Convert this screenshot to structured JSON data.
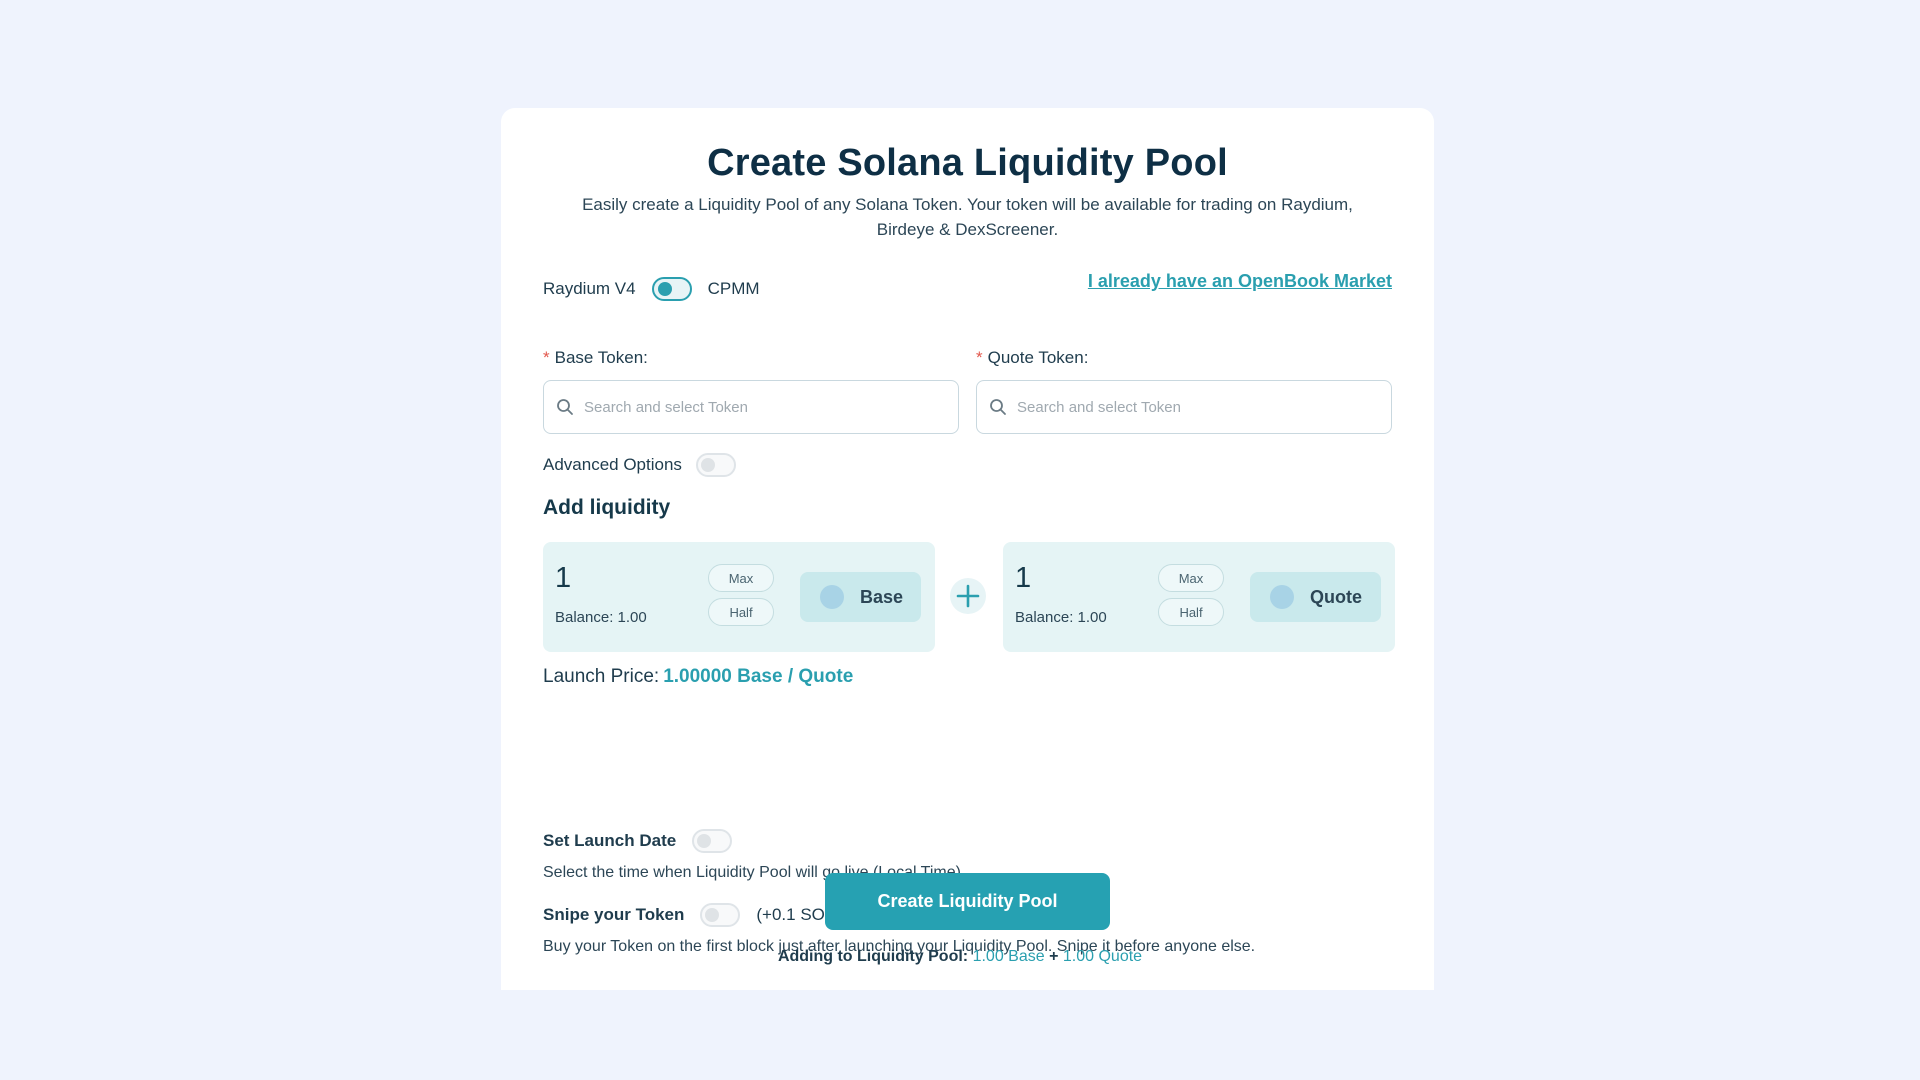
{
  "header": {
    "title": "Create Solana Liquidity Pool",
    "subtitle_line1": "Easily create a Liquidity Pool of any Solana Token. Your token will be available for trading on Raydium,",
    "subtitle_line2": "Birdeye & DexScreener."
  },
  "pool_type": {
    "left_label": "Raydium V4",
    "right_label": "CPMM",
    "toggle_on": true
  },
  "openbook_link": "I already have an OpenBook Market",
  "base_token": {
    "required_mark": "*",
    "label": "Base Token:",
    "placeholder": "Search and select Token"
  },
  "quote_token": {
    "required_mark": "*",
    "label": "Quote Token:",
    "placeholder": "Search and select Token"
  },
  "advanced": {
    "label": "Advanced Options",
    "enabled": false
  },
  "add_liquidity": {
    "title": "Add liquidity",
    "base": {
      "amount": "1",
      "balance": "Balance: 1.00",
      "max": "Max",
      "half": "Half",
      "token": "Base"
    },
    "quote": {
      "amount": "1",
      "balance": "Balance: 1.00",
      "max": "Max",
      "half": "Half",
      "token": "Quote"
    },
    "plus": "+"
  },
  "launch_price": {
    "label": "Launch Price:",
    "value": "1.00000 Base / Quote"
  },
  "launch_date": {
    "label": "Set Launch Date",
    "enabled": false,
    "help": "Select the time when Liquidity Pool will go live (Local Time)"
  },
  "snipe": {
    "label": "Snipe your Token",
    "enabled": false,
    "cost": "(+0.1 SOL)",
    "help": "Buy your Token on the first block just after launching your Liquidity Pool. Snipe it before anyone else."
  },
  "create_button": "Create Liquidity Pool",
  "summary": {
    "prefix": "Adding to Liquidity Pool:",
    "base": "1.00 Base",
    "plus": "+",
    "quote": "1.00 Quote"
  },
  "colors": {
    "accent": "#2a9faf",
    "background": "#eff3fd",
    "card": "#ffffff",
    "required": "#e2574c"
  }
}
